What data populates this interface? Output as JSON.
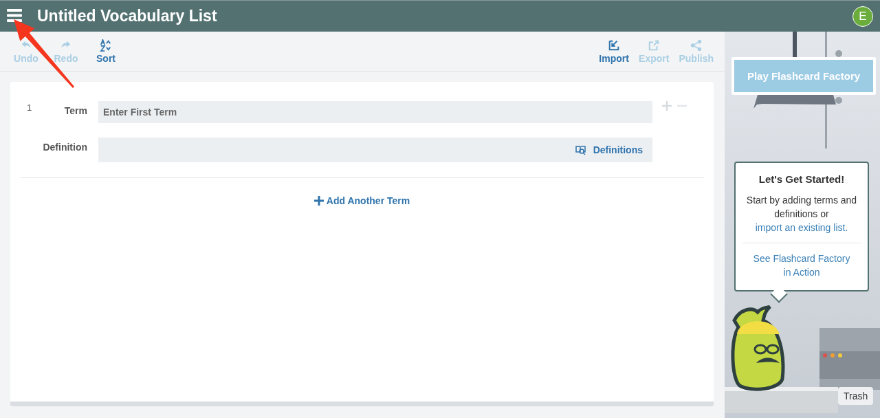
{
  "header": {
    "title": "Untitled Vocabulary List",
    "avatar": "E"
  },
  "toolbar": {
    "left": [
      {
        "label": "Undo",
        "disabled": true
      },
      {
        "label": "Redo",
        "disabled": true
      },
      {
        "label": "Sort",
        "disabled": false
      }
    ],
    "right": [
      {
        "label": "Import",
        "disabled": false
      },
      {
        "label": "Export",
        "disabled": true
      },
      {
        "label": "Publish",
        "disabled": true
      }
    ]
  },
  "terms": [
    {
      "number": "1",
      "term_label": "Term",
      "term_placeholder": "Enter First Term",
      "definition_label": "Definition",
      "definitions_button": "Definitions"
    }
  ],
  "add_term": "Add Another Term",
  "side_panel": {
    "play_button": "Play Flashcard Factory",
    "callout": {
      "title": "Let's Get Started!",
      "text": "Start by adding terms and definitions or",
      "link": "import an existing list.",
      "action_link": "See Flashcard Factory in Action"
    },
    "trash_label": "Trash"
  }
}
